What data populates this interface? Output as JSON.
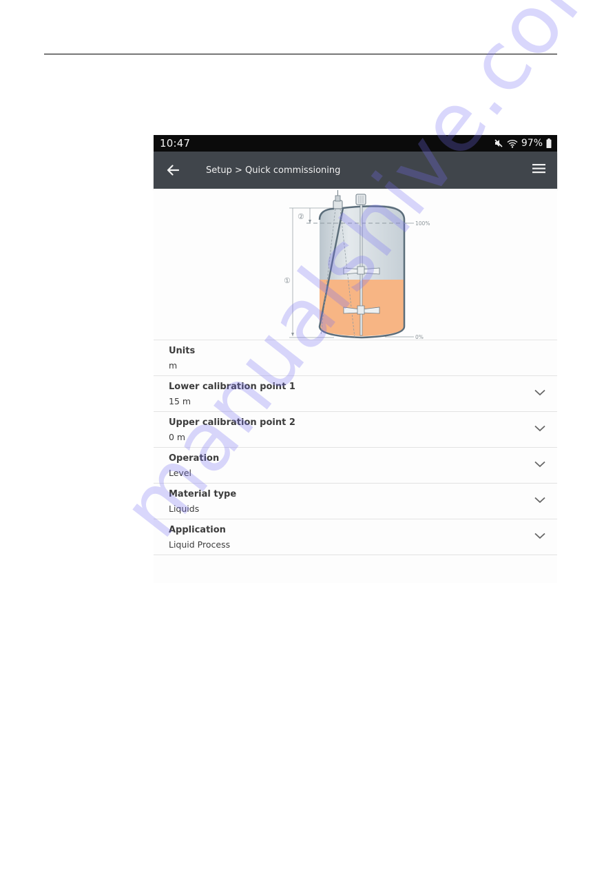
{
  "status_bar": {
    "time": "10:47",
    "battery": "97%",
    "icons": [
      "mute-icon",
      "wifi-icon",
      "battery-icon"
    ]
  },
  "app_bar": {
    "back_icon": "arrow-left-icon",
    "title": "Setup > Quick commissioning",
    "menu_icon": "hamburger-menu-icon"
  },
  "diagram": {
    "label_100": "100%",
    "label_0": "0%",
    "marker_1": "①",
    "marker_2": "②",
    "colors": {
      "liquid": "#f7b584",
      "tank_empty": "#cfd8de",
      "tank_outline": "#5b6d7a"
    }
  },
  "settings": [
    {
      "label": "Units",
      "value": "m",
      "has_dropdown": false
    },
    {
      "label": "Lower calibration point 1",
      "value": "15  m",
      "has_dropdown": true
    },
    {
      "label": "Upper calibration point 2",
      "value": "0  m",
      "has_dropdown": true
    },
    {
      "label": "Operation",
      "value": "Level",
      "has_dropdown": true
    },
    {
      "label": "Material type",
      "value": "Liquids",
      "has_dropdown": true
    },
    {
      "label": "Application",
      "value": "Liquid Process",
      "has_dropdown": true
    }
  ],
  "watermark": "manualshive.com"
}
